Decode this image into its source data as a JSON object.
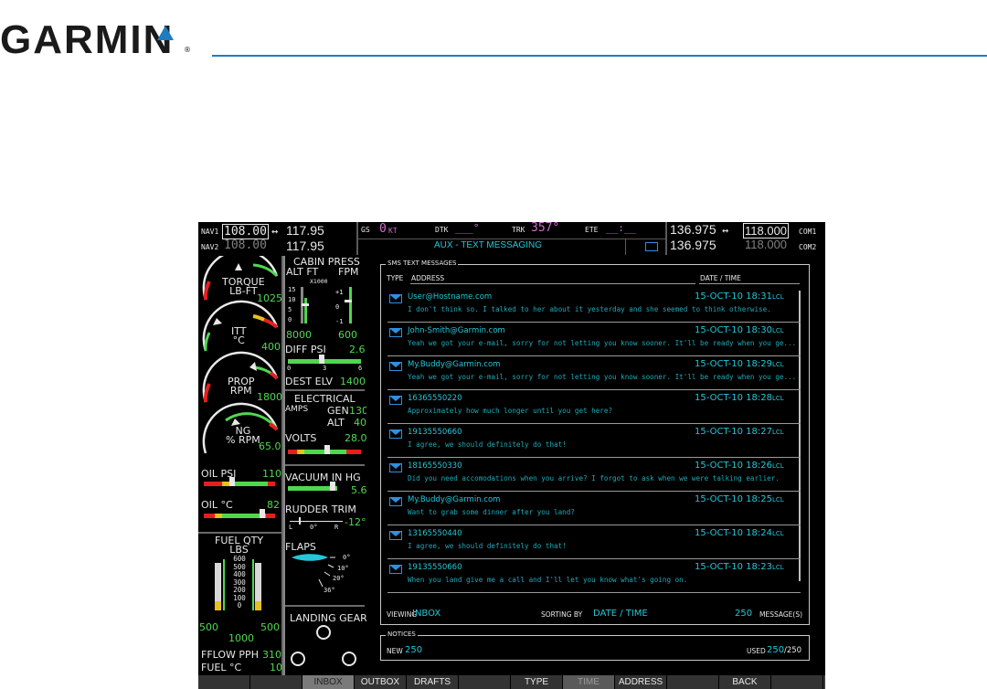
{
  "brand": {
    "logo_text": "GARMIN",
    "registered": "®"
  },
  "topbar": {
    "nav1_label": "NAV1",
    "nav1_active": "108.00",
    "nav1_standby": "117.95",
    "nav2_label": "NAV2",
    "nav2_active": "108.00",
    "nav2_standby": "117.95",
    "gs_label": "GS",
    "gs_value": "0",
    "gs_unit": "KT",
    "dtk_label": "DTK",
    "dtk_value": "___°",
    "trk_label": "TRK",
    "trk_value": "357°",
    "ete_label": "ETE",
    "ete_value": "__:__",
    "page_title": "AUX - TEXT MESSAGING",
    "com1_standby": "136.975",
    "com1_active": "118.000",
    "com1_label": "COM1",
    "com2_standby": "136.975",
    "com2_active": "118.000",
    "com2_label": "COM2",
    "swap_glyph": "↔"
  },
  "engine": {
    "torque_label": "TORQUE\nLB-FT",
    "torque_value": "1025",
    "itt_label": "ITT\n°C",
    "itt_value": "400",
    "prop_label": "PROP\nRPM",
    "prop_value": "1800",
    "ng_label": "NG\n% RPM",
    "ng_value": "65.0",
    "oil_psi_label": "OIL PSI",
    "oil_psi_value": "110",
    "oil_c_label": "OIL °C",
    "oil_c_value": "82",
    "fuel_qty_label": "FUEL QTY\nLBS",
    "fuel_scale": [
      "600",
      "500",
      "400",
      "300",
      "200",
      "100",
      "0"
    ],
    "fuel_left": "500",
    "fuel_right": "500",
    "fuel_total": "1000",
    "fflow_label": "FFLOW PPH",
    "fflow_value": "310",
    "fuel_c_label": "FUEL °C",
    "fuel_c_value": "10"
  },
  "systems": {
    "cabin_press_label": "CABIN PRESS",
    "alt_ft_label": "ALT FT",
    "fpm_label": "FPM",
    "x1000_label": "X1000",
    "alt_scale": [
      "15",
      "10",
      "5",
      "0"
    ],
    "fpm_scale": [
      "+1",
      "0",
      "-1"
    ],
    "cabin_alt_value": "8000",
    "cabin_rate_value": "600",
    "diff_psi_label": "DIFF PSI",
    "diff_psi_value": "2.6",
    "diff_scale": [
      "0",
      "3",
      "6"
    ],
    "dest_elv_label": "DEST ELV",
    "dest_elv_value": "1400",
    "electrical_label": "ELECTRICAL",
    "amps_label": "AMPS",
    "gen_label": "GEN",
    "gen_value": "130",
    "alt_label": "ALT",
    "alt_value": "40",
    "volts_label": "VOLTS",
    "volts_value": "28.0",
    "vacuum_label": "VACUUM IN HG",
    "vacuum_value": "5.6",
    "rudder_label": "RUDDER TRIM",
    "rudder_value": "-12°",
    "rudder_scale": [
      "L",
      "0°",
      "R"
    ],
    "flaps_label": "FLAPS",
    "flaps_scale": [
      "0°",
      "10°",
      "20°",
      "36°"
    ],
    "landing_gear_label": "LANDING GEAR"
  },
  "messages": {
    "panel_title": "SMS TEXT MESSAGES",
    "col_type": "TYPE",
    "col_address": "ADDRESS",
    "col_datetime": "DATE / TIME",
    "lcl": "LCL",
    "items": [
      {
        "address": "User@Hostname.com",
        "time": "15-OCT-10 18:31",
        "text": "I don't think so. I talked to her about it yesterday and she seemed to think otherwise."
      },
      {
        "address": "John-Smith@Garmin.com",
        "time": "15-OCT-10 18:30",
        "text": "Yeah we got your e-mail, sorry for not letting you know sooner. It'll be ready when you ge..."
      },
      {
        "address": "My.Buddy@Garmin.com",
        "time": "15-OCT-10 18:29",
        "text": "Yeah we got your e-mail, sorry for not letting you know sooner. It'll be ready when you ge..."
      },
      {
        "address": "16365550220",
        "time": "15-OCT-10 18:28",
        "text": "Approximately how much longer until you get here?"
      },
      {
        "address": "19135550660",
        "time": "15-OCT-10 18:27",
        "text": "I agree, we should definitely do that!"
      },
      {
        "address": "18165550330",
        "time": "15-OCT-10 18:26",
        "text": "Did you need accomodations when you arrive? I forgot to ask when we were talking earlier."
      },
      {
        "address": "My.Buddy@Garmin.com",
        "time": "15-OCT-10 18:25",
        "text": "Want to grab some dinner after you land?"
      },
      {
        "address": "13165550440",
        "time": "15-OCT-10 18:24",
        "text": "I agree, we should definitely do that!"
      },
      {
        "address": "19135550660",
        "time": "15-OCT-10 18:23",
        "text": "When you land give me a call and I'll let you know what's going on."
      }
    ],
    "viewing_label": "VIEWING",
    "viewing_value": "INBOX",
    "sorting_label": "SORTING BY",
    "sorting_value": "DATE / TIME",
    "message_count": "250",
    "message_count_label": "MESSAGE(S)"
  },
  "notices": {
    "title": "NOTICES",
    "new_label": "NEW",
    "new_value": "250",
    "used_label": "USED",
    "used_value": "250",
    "used_total": "/250"
  },
  "softkeys": [
    "",
    "",
    "INBOX",
    "OUTBOX",
    "DRAFTS",
    "",
    "TYPE",
    "TIME",
    "ADDRESS",
    "",
    "BACK",
    ""
  ],
  "colors": {
    "cyan": "#23c7d8",
    "green": "#4fd84f",
    "magenta": "#d070d0",
    "garmin_blue": "#1f7cc0"
  }
}
